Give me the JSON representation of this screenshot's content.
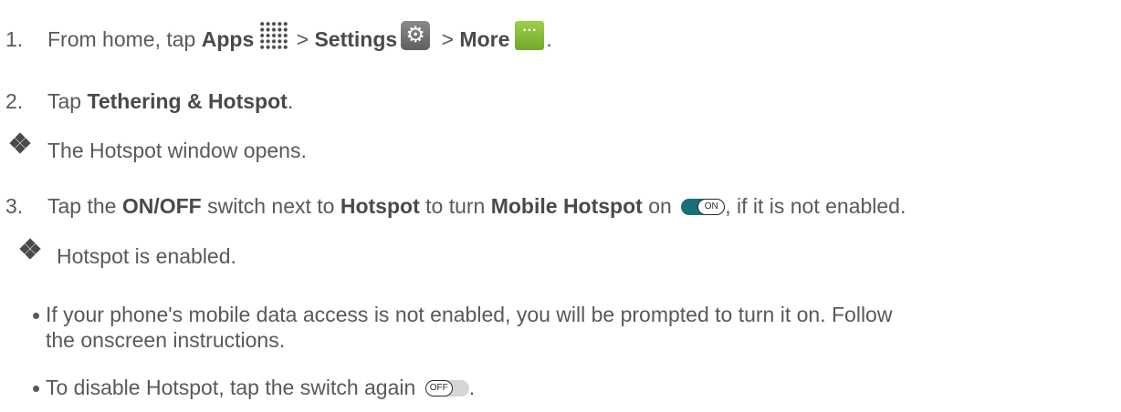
{
  "steps": [
    {
      "number": "1.",
      "parts": [
        "From home, tap ",
        "Apps",
        " > ",
        "Settings",
        " > ",
        "More",
        "."
      ]
    },
    {
      "number": "2.",
      "parts": [
        "Tap ",
        "Tethering & Hotspot",
        "."
      ]
    },
    {
      "number": "3.",
      "parts": [
        "Tap the ",
        "ON/OFF",
        " switch next to ",
        "Hotspot",
        " to turn ",
        "Mobile Hotspot",
        " on ",
        ", if it is not enabled."
      ]
    }
  ],
  "results": {
    "step2": "The Hotspot window opens.",
    "step3": "Hotspot is enabled."
  },
  "sub_bullets": [
    {
      "line1": "If your phone's mobile data access is not enabled, you will be prompted to turn it on. Follow",
      "line2": "the onscreen instructions."
    },
    {
      "text": "To disable Hotspot, tap the switch again ",
      "end": "."
    }
  ],
  "toggles": {
    "on_label": "ON",
    "off_label": "OFF"
  },
  "icons": {
    "apps": "apps-grid-icon",
    "settings": "settings-gear-icon",
    "more": "more-dots-icon",
    "result_bullet": "diamond-bullet-icon"
  },
  "icon_glyphs": {
    "settings": "⚙",
    "more": "···"
  },
  "colors": {
    "text": "#595959",
    "toggle_on": "#17707a",
    "toggle_off": "#d6d6d6",
    "more_icon": "#7cb82f"
  }
}
